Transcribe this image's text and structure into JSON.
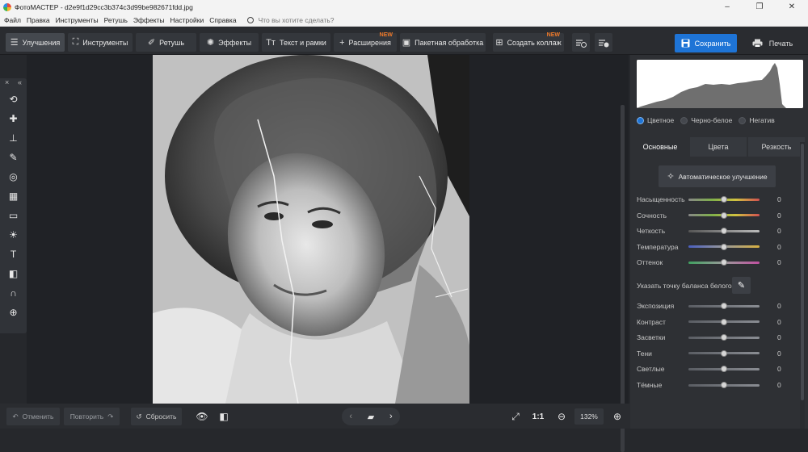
{
  "window": {
    "title": "ФотоМАСТЕР - d2e9f1d29cc3b374c3d99be982671fdd.jpg",
    "minimize": "–",
    "maximize": "❐",
    "close": "✕"
  },
  "menu": {
    "items": [
      "Файл",
      "Правка",
      "Инструменты",
      "Ретушь",
      "Эффекты",
      "Настройки",
      "Справка"
    ],
    "search_placeholder": "Что вы хотите сделать?"
  },
  "toolbar": {
    "tabs": [
      {
        "label": "Улучшения",
        "icon": "☰"
      },
      {
        "label": "Инструменты",
        "icon": "⛶"
      },
      {
        "label": "Ретушь",
        "icon": "✐"
      },
      {
        "label": "Эффекты",
        "icon": "✺"
      },
      {
        "label": "Текст и рамки",
        "icon": "Tт"
      },
      {
        "label": "Расширения",
        "icon": "+",
        "badge": "NEW"
      },
      {
        "label": "Пакетная обработка",
        "icon": "▣"
      },
      {
        "label": "Создать коллаж",
        "icon": "⊞",
        "badge": "NEW"
      }
    ],
    "save_label": "Сохранить",
    "print_label": "Печать"
  },
  "left_tools": [
    "crop-rotate",
    "heal",
    "stamp",
    "brush",
    "radial-filter",
    "gradient-filter",
    "vignette",
    "light",
    "text",
    "fill",
    "magnet",
    "globe"
  ],
  "bottom": {
    "undo_label": "Отменить",
    "redo_label": "Повторить",
    "reset_label": "Сбросить",
    "fit_label": "1:1",
    "zoom_value": "132%"
  },
  "right_panel": {
    "modes": [
      {
        "label": "Цветное",
        "selected": true
      },
      {
        "label": "Черно-белое",
        "selected": false
      },
      {
        "label": "Негатив",
        "selected": false
      }
    ],
    "subtabs": [
      "Основные",
      "Цвета",
      "Резкость"
    ],
    "auto_label": "Автоматическое улучшение",
    "color_sliders": [
      {
        "label": "Насыщенность",
        "value": "0"
      },
      {
        "label": "Сочность",
        "value": "0"
      },
      {
        "label": "Четкость",
        "value": "0"
      },
      {
        "label": "Температура",
        "value": "0"
      },
      {
        "label": "Оттенок",
        "value": "0"
      }
    ],
    "wb_label": "Указать точку баланса белого",
    "tone_sliders": [
      {
        "label": "Экспозиция",
        "value": "0"
      },
      {
        "label": "Контраст",
        "value": "0"
      },
      {
        "label": "Засветки",
        "value": "0"
      },
      {
        "label": "Тени",
        "value": "0"
      },
      {
        "label": "Светлые",
        "value": "0"
      },
      {
        "label": "Тёмные",
        "value": "0"
      }
    ]
  },
  "colors": {
    "accent": "#1e74d6",
    "new_badge": "#f07a2a",
    "panel": "#2e3034",
    "canvas": "#202226"
  }
}
